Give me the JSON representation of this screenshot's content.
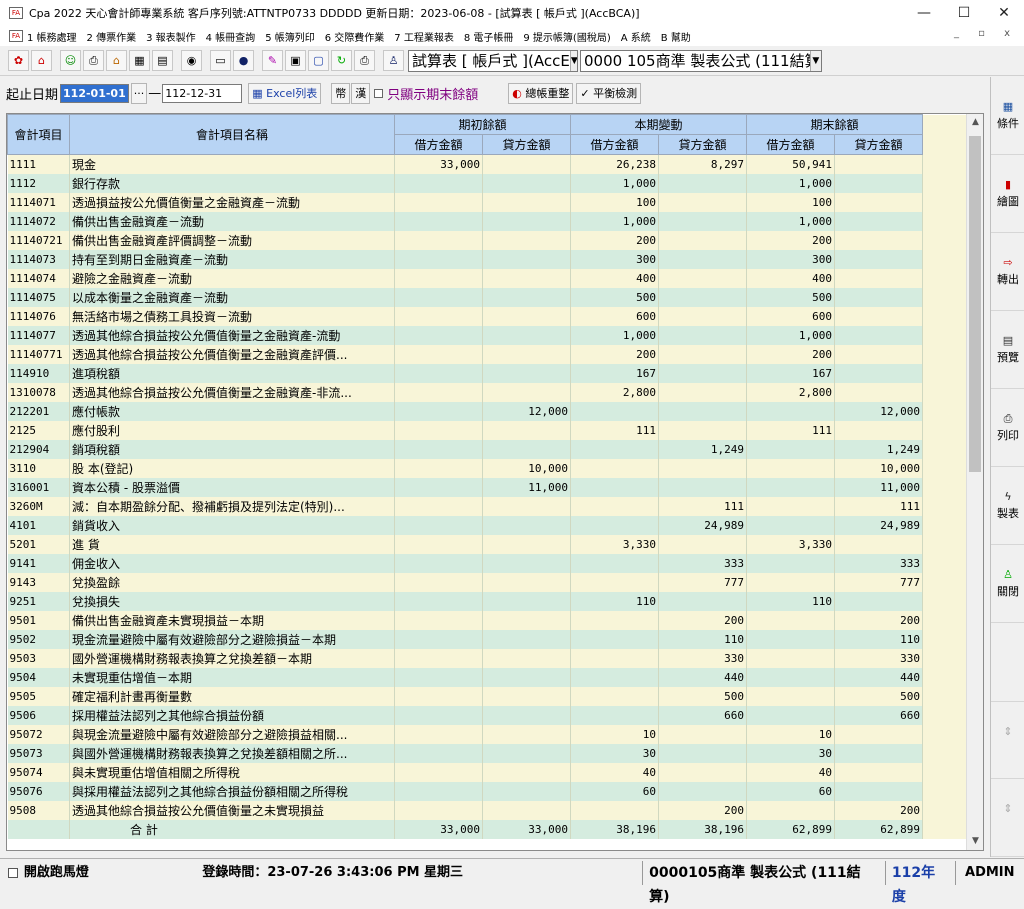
{
  "window": {
    "title": "Cpa 2022 天心會計師專業系統 客戶序列號:ATTNTP0733 DDDDD 更新日期：2023-06-08 - [試算表 [ 帳戶式 ](AccBCA)]",
    "minimize": "—",
    "maximize": "☐",
    "close": "✕"
  },
  "menu": {
    "items": [
      "1 帳務處理",
      "2 傳票作業",
      "3 報表製作",
      "4 帳冊查詢",
      "5 帳簿列印",
      "6 交際費作業",
      "7 工程業報表",
      "8 電子帳冊",
      "9 提示帳簿(國稅局)",
      "A 系統",
      "B 幫助"
    ],
    "mdi_controls": "_ ▫ x"
  },
  "toolbar": {
    "report_combo": "試算表 [ 帳戶式 ](AccE",
    "company_combo": "0000 105商準 製表公式 (111結算)"
  },
  "filters": {
    "date_label": "起止日期",
    "start_date": "112-01-01",
    "ellipsis": "···",
    "dash": "—",
    "end_date": "112-12-31",
    "excel_btn": "Excel列表",
    "currency_btn": "幣",
    "han_btn": "漢",
    "only_end_balance": "只顯示期末餘額",
    "recalc_btn": "總帳重整",
    "balance_btn": "平衡檢測"
  },
  "table": {
    "headers": {
      "code": "會計項目",
      "name": "會計項目名稱",
      "opening": "期初餘額",
      "current": "本期變動",
      "closing": "期末餘額",
      "debit": "借方金額",
      "credit": "貸方金額"
    },
    "rows": [
      {
        "code": "1111",
        "name": "現金",
        "od": "33,000",
        "oc": "",
        "cd": "26,238",
        "cc": "8,297",
        "ed": "50,941",
        "ec": ""
      },
      {
        "code": "1112",
        "name": "銀行存款",
        "od": "",
        "oc": "",
        "cd": "1,000",
        "cc": "",
        "ed": "1,000",
        "ec": ""
      },
      {
        "code": "1114071",
        "name": "透過損益按公允價值衡量之金融資產－流動",
        "od": "",
        "oc": "",
        "cd": "100",
        "cc": "",
        "ed": "100",
        "ec": ""
      },
      {
        "code": "1114072",
        "name": "備供出售金融資產－流動",
        "od": "",
        "oc": "",
        "cd": "1,000",
        "cc": "",
        "ed": "1,000",
        "ec": ""
      },
      {
        "code": "11140721",
        "name": "備供出售金融資產評價調整－流動",
        "od": "",
        "oc": "",
        "cd": "200",
        "cc": "",
        "ed": "200",
        "ec": ""
      },
      {
        "code": "1114073",
        "name": "持有至到期日金融資產－流動",
        "od": "",
        "oc": "",
        "cd": "300",
        "cc": "",
        "ed": "300",
        "ec": ""
      },
      {
        "code": "1114074",
        "name": "避險之金融資產－流動",
        "od": "",
        "oc": "",
        "cd": "400",
        "cc": "",
        "ed": "400",
        "ec": ""
      },
      {
        "code": "1114075",
        "name": "以成本衡量之金融資產－流動",
        "od": "",
        "oc": "",
        "cd": "500",
        "cc": "",
        "ed": "500",
        "ec": ""
      },
      {
        "code": "1114076",
        "name": "無活絡市場之債務工具投資－流動",
        "od": "",
        "oc": "",
        "cd": "600",
        "cc": "",
        "ed": "600",
        "ec": ""
      },
      {
        "code": "1114077",
        "name": "透過其他綜合損益按公允價值衡量之金融資產-流動",
        "od": "",
        "oc": "",
        "cd": "1,000",
        "cc": "",
        "ed": "1,000",
        "ec": ""
      },
      {
        "code": "11140771",
        "name": "透過其他綜合損益按公允價值衡量之金融資產評價...",
        "od": "",
        "oc": "",
        "cd": "200",
        "cc": "",
        "ed": "200",
        "ec": ""
      },
      {
        "code": "114910",
        "name": "進項稅額",
        "od": "",
        "oc": "",
        "cd": "167",
        "cc": "",
        "ed": "167",
        "ec": ""
      },
      {
        "code": "1310078",
        "name": "透過其他綜合損益按公允價值衡量之金融資產-非流...",
        "od": "",
        "oc": "",
        "cd": "2,800",
        "cc": "",
        "ed": "2,800",
        "ec": ""
      },
      {
        "code": "212201",
        "name": "應付帳款",
        "od": "",
        "oc": "12,000",
        "cd": "",
        "cc": "",
        "ed": "",
        "ec": "12,000"
      },
      {
        "code": "2125",
        "name": "應付股利",
        "od": "",
        "oc": "",
        "cd": "111",
        "cc": "",
        "ed": "111",
        "ec": ""
      },
      {
        "code": "212904",
        "name": "銷項稅額",
        "od": "",
        "oc": "",
        "cd": "",
        "cc": "1,249",
        "ed": "",
        "ec": "1,249"
      },
      {
        "code": "3110",
        "name": "股 本(登記)",
        "od": "",
        "oc": "10,000",
        "cd": "",
        "cc": "",
        "ed": "",
        "ec": "10,000"
      },
      {
        "code": "316001",
        "name": "資本公積 - 股票溢價",
        "od": "",
        "oc": "11,000",
        "cd": "",
        "cc": "",
        "ed": "",
        "ec": "11,000"
      },
      {
        "code": "3260M",
        "name": "減：自本期盈餘分配、撥補虧損及提列法定(特別)...",
        "od": "",
        "oc": "",
        "cd": "",
        "cc": "111",
        "ed": "",
        "ec": "111"
      },
      {
        "code": "4101",
        "name": "銷貨收入",
        "od": "",
        "oc": "",
        "cd": "",
        "cc": "24,989",
        "ed": "",
        "ec": "24,989"
      },
      {
        "code": "5201",
        "name": "進 貨",
        "od": "",
        "oc": "",
        "cd": "3,330",
        "cc": "",
        "ed": "3,330",
        "ec": ""
      },
      {
        "code": "9141",
        "name": "佣金收入",
        "od": "",
        "oc": "",
        "cd": "",
        "cc": "333",
        "ed": "",
        "ec": "333"
      },
      {
        "code": "9143",
        "name": "兌換盈餘",
        "od": "",
        "oc": "",
        "cd": "",
        "cc": "777",
        "ed": "",
        "ec": "777"
      },
      {
        "code": "9251",
        "name": "兌換損失",
        "od": "",
        "oc": "",
        "cd": "110",
        "cc": "",
        "ed": "110",
        "ec": ""
      },
      {
        "code": "9501",
        "name": "備供出售金融資產未實現損益－本期",
        "od": "",
        "oc": "",
        "cd": "",
        "cc": "200",
        "ed": "",
        "ec": "200"
      },
      {
        "code": "9502",
        "name": "現金流量避險中屬有效避險部分之避險損益－本期",
        "od": "",
        "oc": "",
        "cd": "",
        "cc": "110",
        "ed": "",
        "ec": "110"
      },
      {
        "code": "9503",
        "name": "國外營運機構財務報表換算之兌換差額－本期",
        "od": "",
        "oc": "",
        "cd": "",
        "cc": "330",
        "ed": "",
        "ec": "330"
      },
      {
        "code": "9504",
        "name": "未實現重估增值－本期",
        "od": "",
        "oc": "",
        "cd": "",
        "cc": "440",
        "ed": "",
        "ec": "440"
      },
      {
        "code": "9505",
        "name": "確定福利計畫再衡量數",
        "od": "",
        "oc": "",
        "cd": "",
        "cc": "500",
        "ed": "",
        "ec": "500"
      },
      {
        "code": "9506",
        "name": "採用權益法認列之其他綜合損益份額",
        "od": "",
        "oc": "",
        "cd": "",
        "cc": "660",
        "ed": "",
        "ec": "660"
      },
      {
        "code": "95072",
        "name": "與現金流量避險中屬有效避險部分之避險損益相關...",
        "od": "",
        "oc": "",
        "cd": "10",
        "cc": "",
        "ed": "10",
        "ec": ""
      },
      {
        "code": "95073",
        "name": "與國外營運機構財務報表換算之兌換差額相關之所...",
        "od": "",
        "oc": "",
        "cd": "30",
        "cc": "",
        "ed": "30",
        "ec": ""
      },
      {
        "code": "95074",
        "name": "與未實現重估增值相關之所得稅",
        "od": "",
        "oc": "",
        "cd": "40",
        "cc": "",
        "ed": "40",
        "ec": ""
      },
      {
        "code": "95076",
        "name": "與採用權益法認列之其他綜合損益份額相關之所得稅",
        "od": "",
        "oc": "",
        "cd": "60",
        "cc": "",
        "ed": "60",
        "ec": ""
      },
      {
        "code": "9508",
        "name": "透過其他綜合損益按公允價值衡量之未實現損益",
        "od": "",
        "oc": "",
        "cd": "",
        "cc": "200",
        "ed": "",
        "ec": "200"
      }
    ],
    "total": {
      "label": "合 計",
      "od": "33,000",
      "oc": "33,000",
      "cd": "38,196",
      "cc": "38,196",
      "ed": "62,899",
      "ec": "62,899"
    }
  },
  "sidepanel": [
    {
      "label": "條件",
      "icon": "table-icon"
    },
    {
      "label": "繪圖",
      "icon": "chart-icon"
    },
    {
      "label": "轉出",
      "icon": "export-icon"
    },
    {
      "label": "預覽",
      "icon": "preview-icon"
    },
    {
      "label": "列印",
      "icon": "printer-icon"
    },
    {
      "label": "製表",
      "icon": "lightning-icon"
    },
    {
      "label": "關閉",
      "icon": "exit-icon"
    }
  ],
  "status": {
    "marquee": "開啟跑馬燈",
    "login_label": "登錄時間：",
    "login_time": "23-07-26 3:43:06 PM 星期三",
    "company": "0000105商準 製表公式 (111結算)",
    "year": "112年度",
    "user": "ADMIN"
  },
  "colors": {
    "header_blue": "#b8d4f4",
    "row_yellow": "#f8f5d8",
    "row_green": "#d5ecdf",
    "year_blue": "#1a3fa8"
  }
}
